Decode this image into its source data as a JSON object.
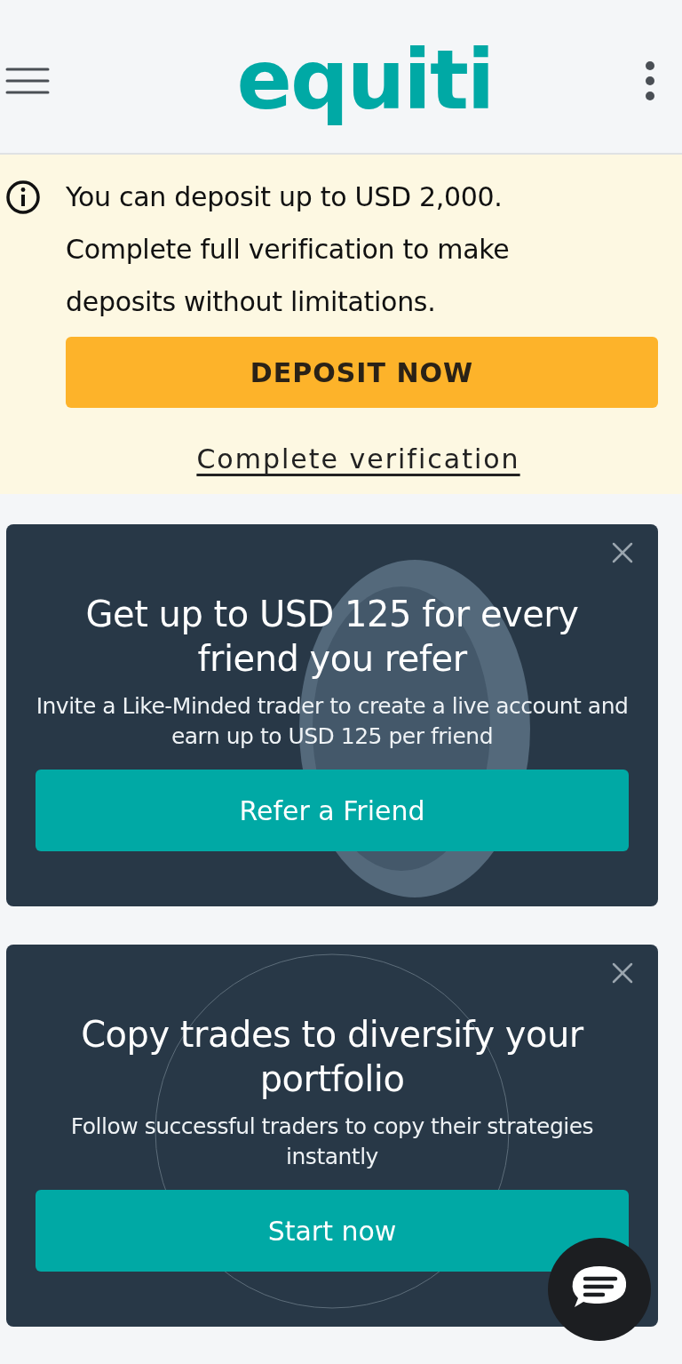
{
  "header": {
    "logo": "equiti"
  },
  "notice": {
    "message": "You can deposit up to USD 2,000. Complete full verification to make deposits without limitations.",
    "primary_button": "DEPOSIT NOW",
    "link": "Complete verification"
  },
  "promos": [
    {
      "kind": "coins",
      "title": "Get up to USD 125 for every friend you refer",
      "description": "Invite a Like-Minded trader to create a live account and earn up to USD 125 per friend",
      "button": "Refer a Friend"
    },
    {
      "kind": "circles",
      "title": "Copy trades to diversify your portfolio",
      "description": "Follow successful traders to copy their strategies instantly",
      "button": "Start now"
    }
  ]
}
